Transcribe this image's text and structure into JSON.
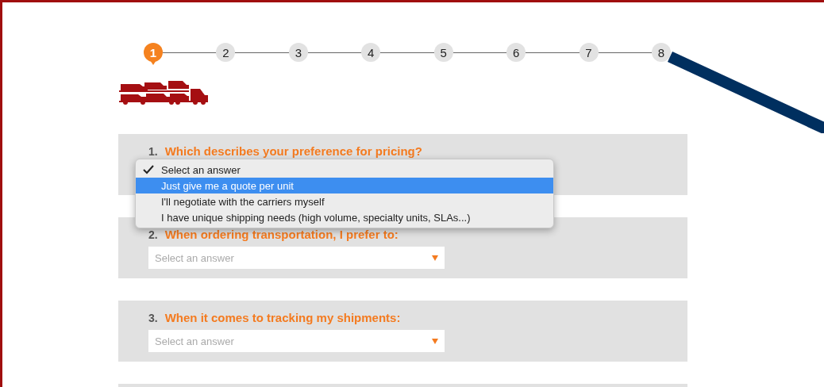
{
  "stepper": {
    "steps": [
      {
        "label": "1",
        "selected": true
      },
      {
        "label": "2",
        "selected": false
      },
      {
        "label": "3",
        "selected": false
      },
      {
        "label": "4",
        "selected": false
      },
      {
        "label": "5",
        "selected": false
      },
      {
        "label": "6",
        "selected": false
      },
      {
        "label": "7",
        "selected": false
      },
      {
        "label": "8",
        "selected": false
      }
    ]
  },
  "questions": [
    {
      "number": "1.",
      "text": "Which describes your preference for pricing?",
      "open": true,
      "options": [
        {
          "label": "Select an answer",
          "checked": true,
          "selected": false
        },
        {
          "label": "Just give me a quote per unit",
          "checked": false,
          "selected": true
        },
        {
          "label": "I'll negotiate with the carriers myself",
          "checked": false,
          "selected": false
        },
        {
          "label": "I have unique shipping needs (high volume, specialty units, SLAs...)",
          "checked": false,
          "selected": false
        }
      ]
    },
    {
      "number": "2.",
      "text": "When ordering transportation, I prefer to:",
      "open": false,
      "placeholder": "Select an answer"
    },
    {
      "number": "3.",
      "text": "When it comes to tracking my shipments:",
      "open": false,
      "placeholder": "Select an answer"
    }
  ]
}
